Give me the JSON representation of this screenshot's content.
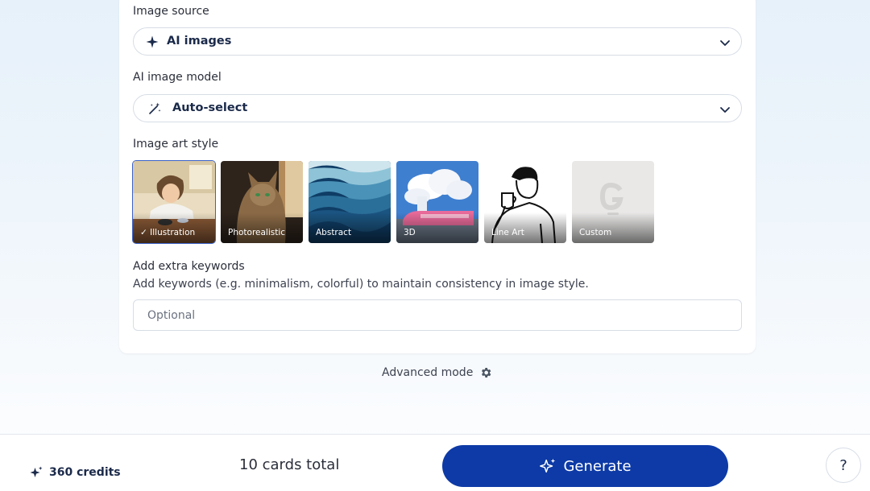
{
  "image_source": {
    "label": "Image source",
    "selected": "AI images",
    "icon": "sparkle-icon"
  },
  "ai_model": {
    "label": "AI image model",
    "selected": "Auto-select",
    "icon": "magic-wand-icon"
  },
  "art_style": {
    "label": "Image art style",
    "selected": "Illustration",
    "options": [
      {
        "label": "Illustration"
      },
      {
        "label": "Photorealistic"
      },
      {
        "label": "Abstract"
      },
      {
        "label": "3D"
      },
      {
        "label": "Line Art"
      },
      {
        "label": "Custom"
      }
    ]
  },
  "keywords": {
    "label": "Add extra keywords",
    "description": "Add keywords (e.g. minimalism, colorful) to maintain consistency in image style.",
    "placeholder": "Optional"
  },
  "advanced": {
    "label": "Advanced mode",
    "icon": "gear-icon"
  },
  "footer": {
    "credits": "360 credits",
    "cards_total": "10 cards total",
    "generate_label": "Generate",
    "help_label": "?"
  },
  "colors": {
    "primary": "#0d3aa6",
    "selected_outline": "#3b63c9"
  }
}
